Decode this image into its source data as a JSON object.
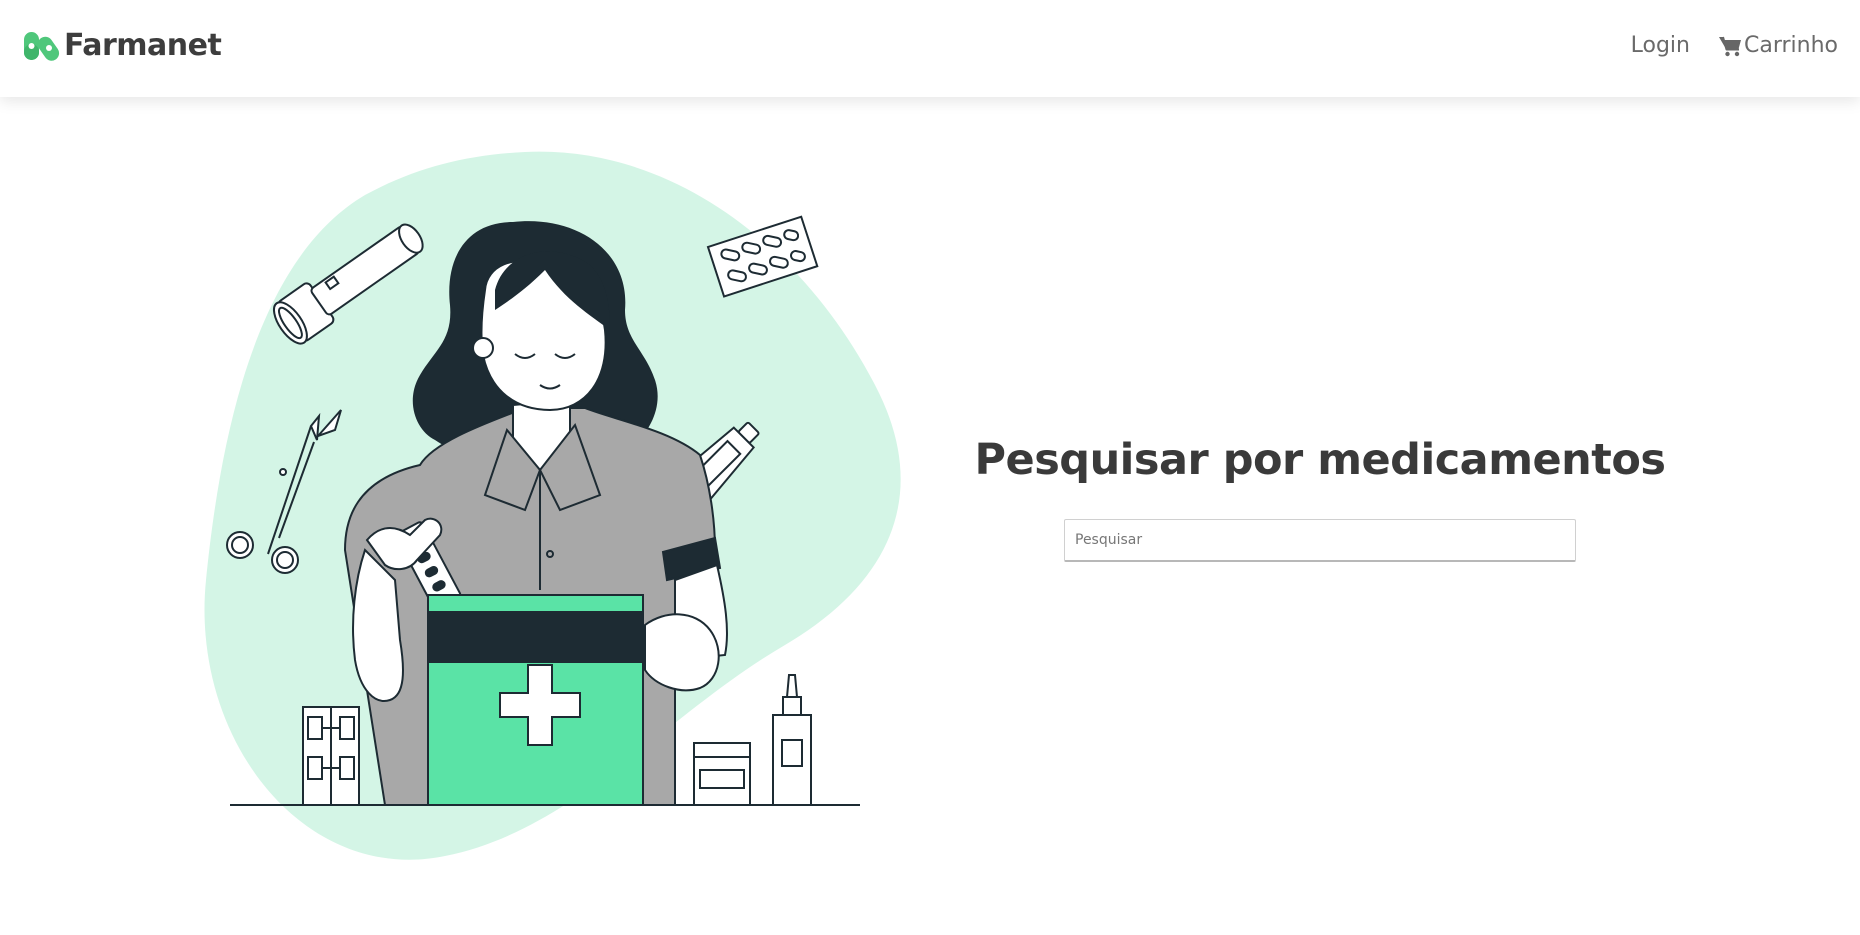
{
  "brand": {
    "name": "Farmanet",
    "logo_icon": "capsule-logo-icon",
    "accent_color": "#4fc77b"
  },
  "nav": {
    "login_label": "Login",
    "cart_label": "Carrinho",
    "cart_icon": "shopping-cart-icon"
  },
  "hero": {
    "illustration": "pharmacist-with-first-aid-kit",
    "blob_color": "#d4f5e6",
    "kit_color": "#5ae3a6",
    "dark_color": "#1d2b33"
  },
  "search": {
    "title": "Pesquisar por medicamentos",
    "placeholder": "Pesquisar",
    "value": ""
  }
}
